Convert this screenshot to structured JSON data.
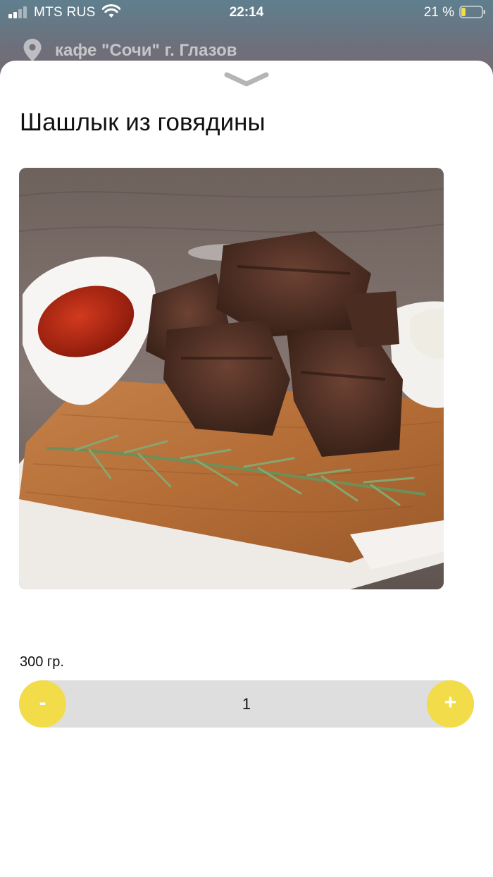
{
  "status_bar": {
    "carrier": "MTS RUS",
    "time": "22:14",
    "battery_percent": "21 %",
    "battery_level": 0.21,
    "signal_bars": 2,
    "icons": [
      "signal-icon",
      "wifi-icon",
      "battery-icon"
    ]
  },
  "header": {
    "location": "кафе \"Сочи\" г. Глазов",
    "icon": "map-pin-icon"
  },
  "product": {
    "collapse_icon": "chevron-down-icon",
    "title": "Шашлык из говядины",
    "image_alt": "dish-photo",
    "weight": "300 гр.",
    "quantity": "1",
    "minus_label": "-",
    "plus_label": "+"
  },
  "colors": {
    "accent": "#f2dc4a",
    "stepper_bg": "#dedede",
    "sheet_bg": "#ffffff"
  }
}
